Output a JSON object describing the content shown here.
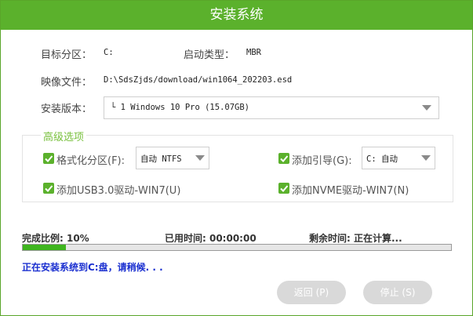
{
  "window": {
    "title": "安装系统"
  },
  "target_partition": {
    "label": "目标分区：",
    "value": "C:"
  },
  "boot_type": {
    "label": "启动类型：",
    "value": "MBR"
  },
  "image_file": {
    "label": "映像文件：",
    "value": "D:\\SdsZjds/download/win1064_202203.esd"
  },
  "install_version": {
    "label": "安装版本：",
    "value": "└ 1 Windows 10 Pro (15.07GB)"
  },
  "advanced": {
    "title": "高级选项",
    "format": {
      "label": "格式化分区(F):",
      "checked": true,
      "select_value": "自动 NTFS"
    },
    "boot_guide": {
      "label": "添加引导(G):",
      "checked": true,
      "select_value": "C: 自动"
    },
    "usb3": {
      "label": "添加USB3.0驱动-WIN7(U)",
      "checked": true
    },
    "nvme": {
      "label": "添加NVME驱动-WIN7(N)",
      "checked": true
    }
  },
  "progress": {
    "complete_label": "完成比例: 10%",
    "percent": 10,
    "elapsed_label": "已用时间: 00:00:00",
    "remaining_label": "剩余时间: 正在计算..."
  },
  "status": "正在安装系统到C:盘，请稍候. . .",
  "buttons": {
    "back": "返回 (P)",
    "stop": "停止 (S)"
  },
  "colors": {
    "accent": "#5bb12c",
    "status_text": "#1a2fd0",
    "progress_fill": "#3fb51f"
  }
}
